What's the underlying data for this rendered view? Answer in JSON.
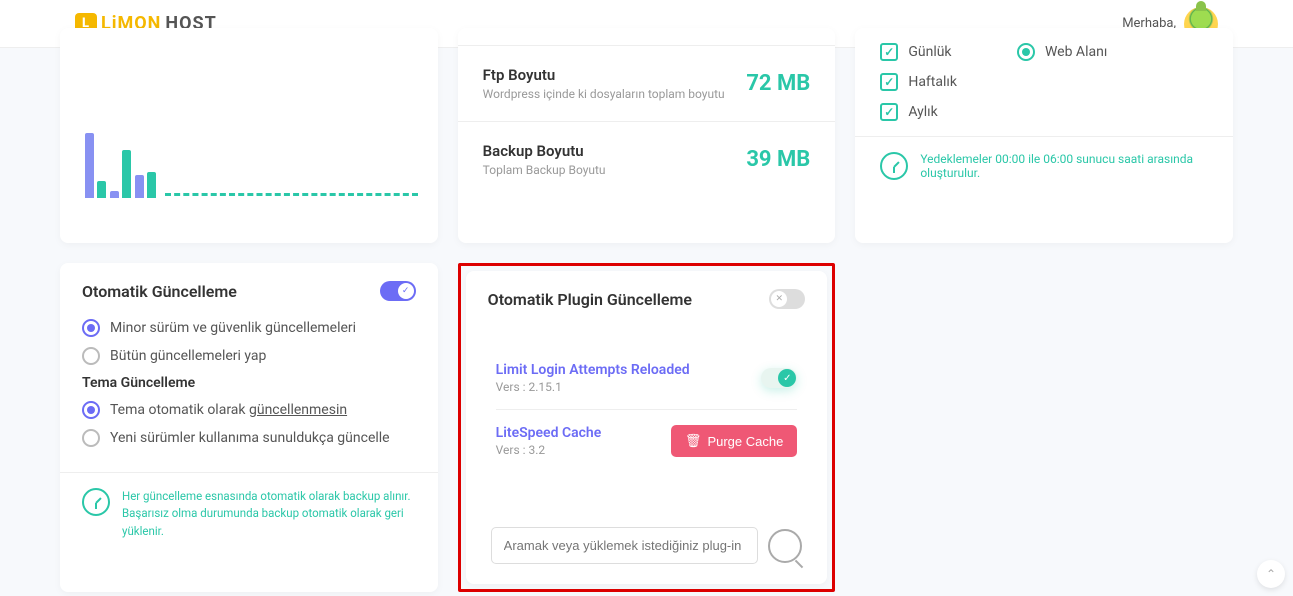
{
  "header": {
    "logo_l": "L",
    "logo_text1": "LiMON",
    "logo_text2": "HOST",
    "greeting": "Merhaba,"
  },
  "chart_data": {
    "type": "bar",
    "series": [
      {
        "name": "indigo",
        "values": [
          65,
          7,
          23,
          0,
          0,
          0,
          0,
          0,
          0,
          0,
          0,
          0,
          0,
          0,
          0,
          0
        ]
      },
      {
        "name": "teal",
        "values": [
          17,
          48,
          26,
          0,
          0,
          0,
          0,
          0,
          0,
          0,
          0,
          0,
          0,
          0,
          0,
          0
        ]
      }
    ]
  },
  "sizes": [
    {
      "title": "Ftp Boyutu",
      "sub": "Wordpress içinde ki dosyaların toplam boyutu",
      "value": "72 MB"
    },
    {
      "title": "Backup Boyutu",
      "sub": "Toplam Backup Boyutu",
      "value": "39 MB"
    }
  ],
  "backup_opts": {
    "checks": [
      "Günlük",
      "Haftalık",
      "Aylık"
    ],
    "radio": "Web Alanı",
    "info": "Yedeklemeler 00:00 ile 06:00 sunucu saati arasında oluşturulur."
  },
  "auto_update": {
    "title": "Otomatik Güncelleme",
    "opt1": "Minor sürüm ve güvenlik güncellemeleri",
    "opt2": "Bütün güncellemeleri yap",
    "theme_title": "Tema Güncelleme",
    "theme_opt1": "Tema otomatik olarak ",
    "theme_opt1_u": "güncellenmesin",
    "theme_opt2": "Yeni sürümler kullanıma sunuldukça güncelle",
    "info": "Her güncelleme esnasında otomatik olarak backup alınır. Başarısız olma durumunda backup otomatik olarak geri yüklenir."
  },
  "plugin_update": {
    "title": "Otomatik Plugin Güncelleme",
    "plugins": [
      {
        "name": "Limit Login Attempts Reloaded",
        "vers": "Vers : 2.15.1"
      },
      {
        "name": "LiteSpeed Cache",
        "vers": "Vers : 3.2"
      }
    ],
    "purge_label": "Purge Cache",
    "search_placeholder": "Aramak veya yüklemek istediğiniz plug-in adını yazın"
  }
}
